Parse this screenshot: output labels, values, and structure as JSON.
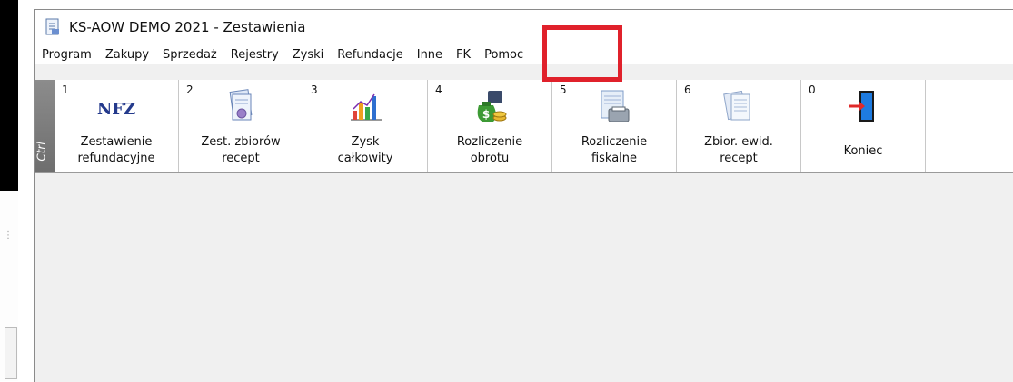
{
  "window": {
    "title": "KS-AOW DEMO 2021 - Zestawienia"
  },
  "menu": [
    "Program",
    "Zakupy",
    "Sprzedaż",
    "Rejestry",
    "Zyski",
    "Refundacje",
    "Inne",
    "FK",
    "Pomoc"
  ],
  "toolbar": {
    "ctrl_label": "Ctrl",
    "buttons": [
      {
        "number": "1",
        "icon": "nfz-logo-icon",
        "line1": "Zestawienie",
        "line2": "refundacyjne"
      },
      {
        "number": "2",
        "icon": "prescription-document-icon",
        "line1": "Zest. zbiorów",
        "line2": "recept"
      },
      {
        "number": "3",
        "icon": "bar-chart-icon",
        "line1": "Zysk",
        "line2": "całkowity"
      },
      {
        "number": "4",
        "icon": "money-bag-icon",
        "line1": "Rozliczenie",
        "line2": "obrotu"
      },
      {
        "number": "5",
        "icon": "fiscal-printer-icon",
        "line1": "Rozliczenie",
        "line2": "fiskalne"
      },
      {
        "number": "6",
        "icon": "documents-icon",
        "line1": "Zbior. ewid.",
        "line2": "recept"
      },
      {
        "number": "0",
        "icon": "exit-door-icon",
        "line1": "Koniec"
      }
    ]
  },
  "nfz_logo_text": "NFZ",
  "colors": {
    "highlight": "#e0212b",
    "ctrl_bar": "#7a7a7a",
    "window_bg": "#f0f0f0"
  }
}
